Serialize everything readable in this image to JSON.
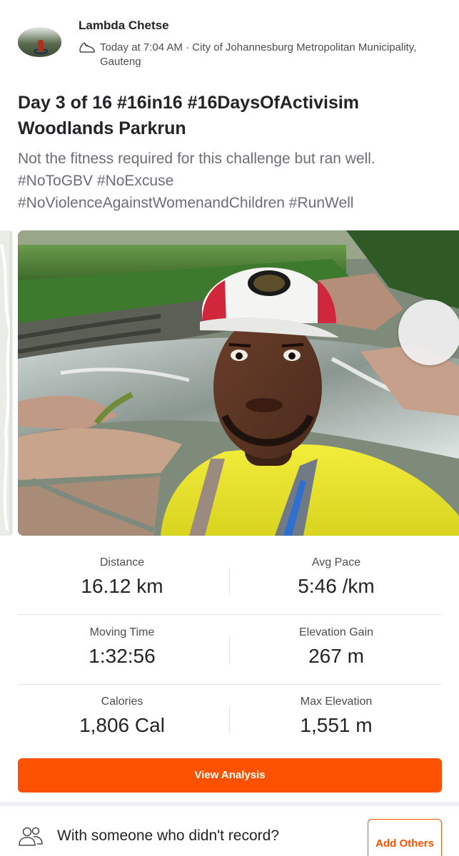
{
  "header": {
    "athlete_name": "Lambda Chetse",
    "meta_line": "Today at 7:04 AM · City of Johannesburg Metropolitan Municipality, Gauteng",
    "activity_icon": "shoe-icon"
  },
  "activity": {
    "title": "Day 3 of 16 #16in16 #16DaysOfActivisim Woodlands Parkrun",
    "description": "Not the fitness required for this challenge but ran well.\n#NoToGBV #NoExcuse\n#NoViolenceAgainstWomenandChildren #RunWell"
  },
  "stats": [
    {
      "label": "Distance",
      "value": "16.12 km"
    },
    {
      "label": "Avg Pace",
      "value": "5:46 /km"
    },
    {
      "label": "Moving Time",
      "value": "1:32:56"
    },
    {
      "label": "Elevation Gain",
      "value": "267 m"
    },
    {
      "label": "Calories",
      "value": "1,806 Cal"
    },
    {
      "label": "Max Elevation",
      "value": "1,551 m"
    }
  ],
  "actions": {
    "view_analysis": "View Analysis",
    "with_someone": "With someone who didn't record?",
    "add_others": "Add Others"
  },
  "colors": {
    "accent": "#fc5200",
    "text": "#242428",
    "muted": "#6d6d78"
  }
}
